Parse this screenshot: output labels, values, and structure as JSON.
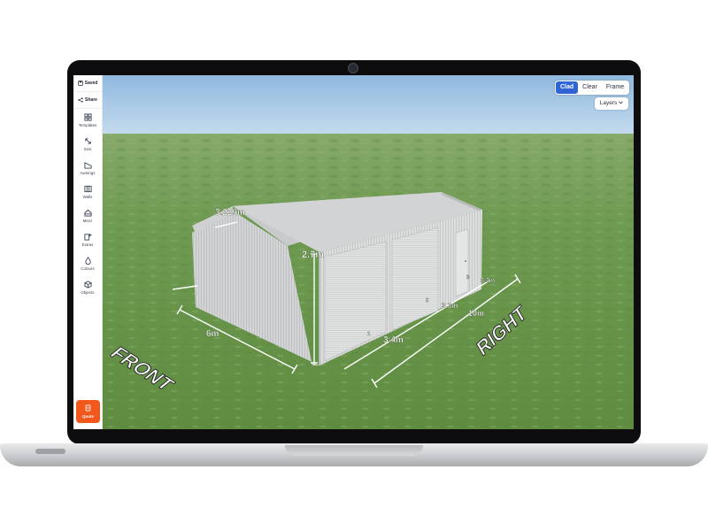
{
  "sidebar": {
    "saved_label": "Saved",
    "share_label": "Share",
    "items": [
      {
        "label": "Templates",
        "icon": "grid-icon"
      },
      {
        "label": "Size",
        "icon": "resize-arrows-icon"
      },
      {
        "label": "Awnings",
        "icon": "awning-icon"
      },
      {
        "label": "Walls",
        "icon": "wall-panel-icon"
      },
      {
        "label": "Mezz",
        "icon": "house-icon"
      },
      {
        "label": "Extras",
        "icon": "door-plus-icon"
      },
      {
        "label": "Colours",
        "icon": "droplet-icon"
      },
      {
        "label": "Objects",
        "icon": "cube-icon"
      }
    ],
    "quote_label": "Quote"
  },
  "view_toggle": {
    "options": [
      "Clad",
      "Clear",
      "Frame"
    ],
    "selected": "Clad"
  },
  "layers_label": "Layers",
  "dimensions": {
    "roof_width": "3.229m",
    "wall_height": "2.7m",
    "front_width": "6m",
    "bay_1": "3.4m",
    "bay_2": "3.3m",
    "bay_3": "3.3m",
    "total_length": "10m",
    "bay_marker_1": "1",
    "bay_marker_2": "2",
    "bay_marker_3": "3"
  },
  "ground_labels": {
    "front": "FRONT",
    "right": "RIGHT"
  },
  "colors": {
    "accent": "#2f64d6",
    "quote_button": "#f2571c",
    "sky": "#a5c7e6",
    "grass": "#6a9a4c",
    "shed": "#d9dadb"
  }
}
